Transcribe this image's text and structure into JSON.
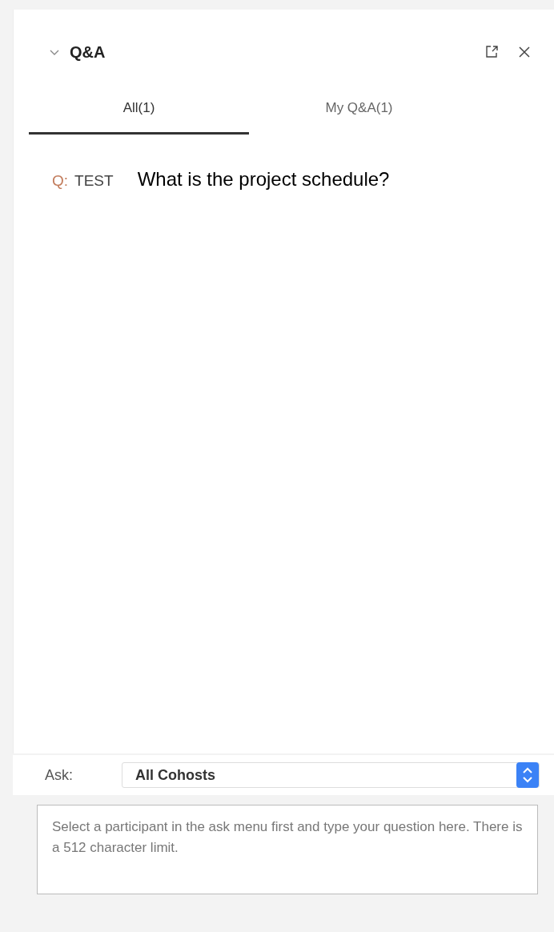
{
  "panel": {
    "title": "Q&A"
  },
  "tabs": [
    {
      "label": "All(1)",
      "selected": true
    },
    {
      "label": "My Q&A(1)",
      "selected": false
    }
  ],
  "questions": [
    {
      "prefix": "Q:",
      "author": "TEST",
      "text": "What is the project schedule?"
    }
  ],
  "ask": {
    "label": "Ask:",
    "value": "All Cohosts"
  },
  "question_input": {
    "placeholder": "Select a participant in the ask menu first and type your question here. There is a 512 character limit."
  }
}
